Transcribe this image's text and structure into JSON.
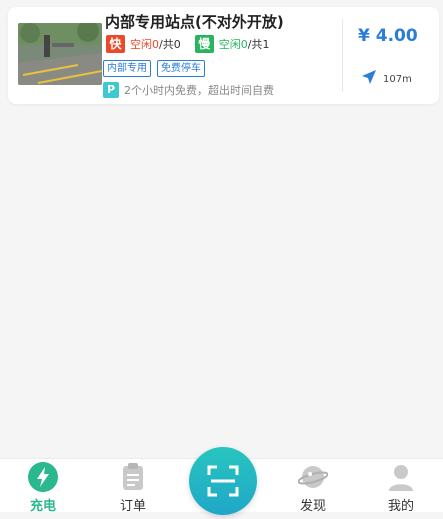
{
  "station": {
    "name": "内部专用站点(不对外开放)",
    "fast": {
      "badge": "快",
      "idle_label": "空闲",
      "idle": "0",
      "sep": "/共",
      "total": "0"
    },
    "slow": {
      "badge": "慢",
      "idle_label": "空闲",
      "idle": "0",
      "sep": "/共",
      "total": "1"
    },
    "tags": [
      "内部专用",
      "免费停车"
    ],
    "parking": {
      "badge": "P",
      "note": "2个小时内免费，超出时间自费"
    },
    "price": "¥ 4.00",
    "distance": "107m"
  },
  "tabs": {
    "charge": "充电",
    "orders": "订单",
    "discover": "发现",
    "mine": "我的"
  },
  "colors": {
    "accent_blue": "#2b7dd8",
    "fast_red": "#e84a2a",
    "slow_green": "#29b55e",
    "active_tab": "#2bb88f",
    "scan_teal": "#22b6c4"
  }
}
